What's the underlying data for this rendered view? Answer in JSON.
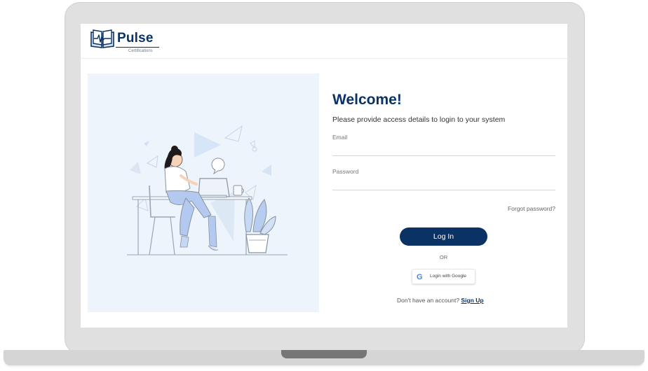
{
  "brand": {
    "name": "Pulse",
    "tagline": "Certifications",
    "icon": "open-book-pulse-icon",
    "color": "#0b3264"
  },
  "login": {
    "title": "Welcome!",
    "subtitle": "Please provide access details to login to your system",
    "email_label": "Email",
    "email_value": "",
    "password_label": "Password",
    "password_value": "",
    "forgot_label": "Forgot password?",
    "submit_label": "Log In",
    "divider_label": "OR",
    "google_label": "Login with Google",
    "google_icon": "google-g-icon",
    "signup_prompt": "Don't have an account?",
    "signup_label": "Sign Up"
  },
  "illustration": {
    "description_icon": "woman-at-laptop-illustration",
    "background": "#eef4fb"
  },
  "colors": {
    "primary": "#0b3264",
    "panel": "#eef4fb"
  }
}
